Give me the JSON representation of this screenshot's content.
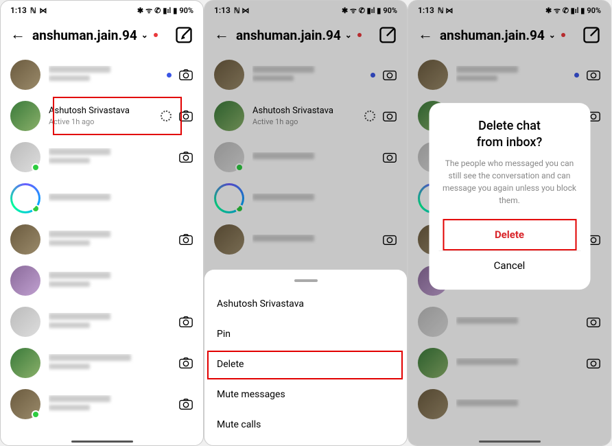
{
  "status": {
    "time": "1:13",
    "indicators": "⇄ ᴺ ⋈",
    "right": "✱ ⏚ ᯤ 📞 ⇅ ▮90%",
    "battery": "90%"
  },
  "header": {
    "username": "anshuman.jain.94"
  },
  "chats": [
    {
      "name": "",
      "sub": "",
      "blurred": true,
      "has_blue_dot": true,
      "has_camera": true,
      "avatar": "color1"
    },
    {
      "name": "Ashutosh Srivastava",
      "sub": "Active 1h ago",
      "blurred": false,
      "has_spinner": true,
      "has_camera": true,
      "avatar": "color2",
      "highlighted_in_panel1": true
    },
    {
      "name": "",
      "sub": "",
      "blurred": true,
      "has_presence": true,
      "has_camera": true,
      "avatar": ""
    },
    {
      "name": "",
      "sub": "",
      "blurred": true,
      "has_presence": true,
      "avatar": "ring"
    },
    {
      "name": "",
      "sub": "",
      "blurred": true,
      "has_camera": true,
      "avatar": "color1"
    },
    {
      "name": "",
      "sub": "",
      "blurred": true,
      "has_camera": false,
      "avatar": "color3"
    },
    {
      "name": "",
      "sub": "",
      "blurred": true,
      "has_camera": true,
      "avatar": ""
    },
    {
      "name": "",
      "sub": "",
      "blurred": true,
      "has_camera": true,
      "avatar": "color2"
    },
    {
      "name": "",
      "sub": "",
      "blurred": true,
      "has_presence": true,
      "has_camera": true,
      "avatar": "color1"
    }
  ],
  "sheet": {
    "title": "Ashutosh Srivastava",
    "items": [
      "Pin",
      "Delete",
      "Mute messages",
      "Mute calls"
    ],
    "highlighted_index": 1
  },
  "dialog": {
    "title": "Delete chat\nfrom inbox?",
    "body": "The people who messaged you can still see the conversation and can message you again unless you block them.",
    "delete_label": "Delete",
    "cancel_label": "Cancel"
  }
}
